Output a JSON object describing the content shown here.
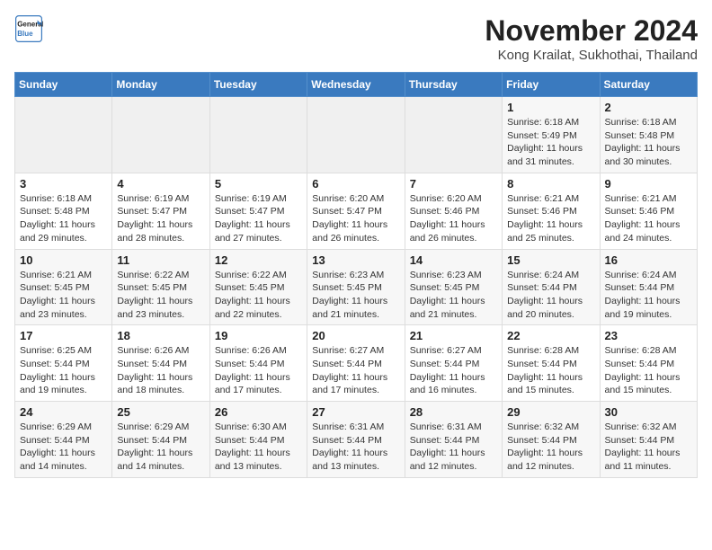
{
  "header": {
    "logo_line1": "General",
    "logo_line2": "Blue",
    "month_title": "November 2024",
    "location": "Kong Krailat, Sukhothai, Thailand"
  },
  "weekdays": [
    "Sunday",
    "Monday",
    "Tuesday",
    "Wednesday",
    "Thursday",
    "Friday",
    "Saturday"
  ],
  "weeks": [
    [
      {
        "day": "",
        "info": ""
      },
      {
        "day": "",
        "info": ""
      },
      {
        "day": "",
        "info": ""
      },
      {
        "day": "",
        "info": ""
      },
      {
        "day": "",
        "info": ""
      },
      {
        "day": "1",
        "info": "Sunrise: 6:18 AM\nSunset: 5:49 PM\nDaylight: 11 hours and 31 minutes."
      },
      {
        "day": "2",
        "info": "Sunrise: 6:18 AM\nSunset: 5:48 PM\nDaylight: 11 hours and 30 minutes."
      }
    ],
    [
      {
        "day": "3",
        "info": "Sunrise: 6:18 AM\nSunset: 5:48 PM\nDaylight: 11 hours and 29 minutes."
      },
      {
        "day": "4",
        "info": "Sunrise: 6:19 AM\nSunset: 5:47 PM\nDaylight: 11 hours and 28 minutes."
      },
      {
        "day": "5",
        "info": "Sunrise: 6:19 AM\nSunset: 5:47 PM\nDaylight: 11 hours and 27 minutes."
      },
      {
        "day": "6",
        "info": "Sunrise: 6:20 AM\nSunset: 5:47 PM\nDaylight: 11 hours and 26 minutes."
      },
      {
        "day": "7",
        "info": "Sunrise: 6:20 AM\nSunset: 5:46 PM\nDaylight: 11 hours and 26 minutes."
      },
      {
        "day": "8",
        "info": "Sunrise: 6:21 AM\nSunset: 5:46 PM\nDaylight: 11 hours and 25 minutes."
      },
      {
        "day": "9",
        "info": "Sunrise: 6:21 AM\nSunset: 5:46 PM\nDaylight: 11 hours and 24 minutes."
      }
    ],
    [
      {
        "day": "10",
        "info": "Sunrise: 6:21 AM\nSunset: 5:45 PM\nDaylight: 11 hours and 23 minutes."
      },
      {
        "day": "11",
        "info": "Sunrise: 6:22 AM\nSunset: 5:45 PM\nDaylight: 11 hours and 23 minutes."
      },
      {
        "day": "12",
        "info": "Sunrise: 6:22 AM\nSunset: 5:45 PM\nDaylight: 11 hours and 22 minutes."
      },
      {
        "day": "13",
        "info": "Sunrise: 6:23 AM\nSunset: 5:45 PM\nDaylight: 11 hours and 21 minutes."
      },
      {
        "day": "14",
        "info": "Sunrise: 6:23 AM\nSunset: 5:45 PM\nDaylight: 11 hours and 21 minutes."
      },
      {
        "day": "15",
        "info": "Sunrise: 6:24 AM\nSunset: 5:44 PM\nDaylight: 11 hours and 20 minutes."
      },
      {
        "day": "16",
        "info": "Sunrise: 6:24 AM\nSunset: 5:44 PM\nDaylight: 11 hours and 19 minutes."
      }
    ],
    [
      {
        "day": "17",
        "info": "Sunrise: 6:25 AM\nSunset: 5:44 PM\nDaylight: 11 hours and 19 minutes."
      },
      {
        "day": "18",
        "info": "Sunrise: 6:26 AM\nSunset: 5:44 PM\nDaylight: 11 hours and 18 minutes."
      },
      {
        "day": "19",
        "info": "Sunrise: 6:26 AM\nSunset: 5:44 PM\nDaylight: 11 hours and 17 minutes."
      },
      {
        "day": "20",
        "info": "Sunrise: 6:27 AM\nSunset: 5:44 PM\nDaylight: 11 hours and 17 minutes."
      },
      {
        "day": "21",
        "info": "Sunrise: 6:27 AM\nSunset: 5:44 PM\nDaylight: 11 hours and 16 minutes."
      },
      {
        "day": "22",
        "info": "Sunrise: 6:28 AM\nSunset: 5:44 PM\nDaylight: 11 hours and 15 minutes."
      },
      {
        "day": "23",
        "info": "Sunrise: 6:28 AM\nSunset: 5:44 PM\nDaylight: 11 hours and 15 minutes."
      }
    ],
    [
      {
        "day": "24",
        "info": "Sunrise: 6:29 AM\nSunset: 5:44 PM\nDaylight: 11 hours and 14 minutes."
      },
      {
        "day": "25",
        "info": "Sunrise: 6:29 AM\nSunset: 5:44 PM\nDaylight: 11 hours and 14 minutes."
      },
      {
        "day": "26",
        "info": "Sunrise: 6:30 AM\nSunset: 5:44 PM\nDaylight: 11 hours and 13 minutes."
      },
      {
        "day": "27",
        "info": "Sunrise: 6:31 AM\nSunset: 5:44 PM\nDaylight: 11 hours and 13 minutes."
      },
      {
        "day": "28",
        "info": "Sunrise: 6:31 AM\nSunset: 5:44 PM\nDaylight: 11 hours and 12 minutes."
      },
      {
        "day": "29",
        "info": "Sunrise: 6:32 AM\nSunset: 5:44 PM\nDaylight: 11 hours and 12 minutes."
      },
      {
        "day": "30",
        "info": "Sunrise: 6:32 AM\nSunset: 5:44 PM\nDaylight: 11 hours and 11 minutes."
      }
    ]
  ]
}
